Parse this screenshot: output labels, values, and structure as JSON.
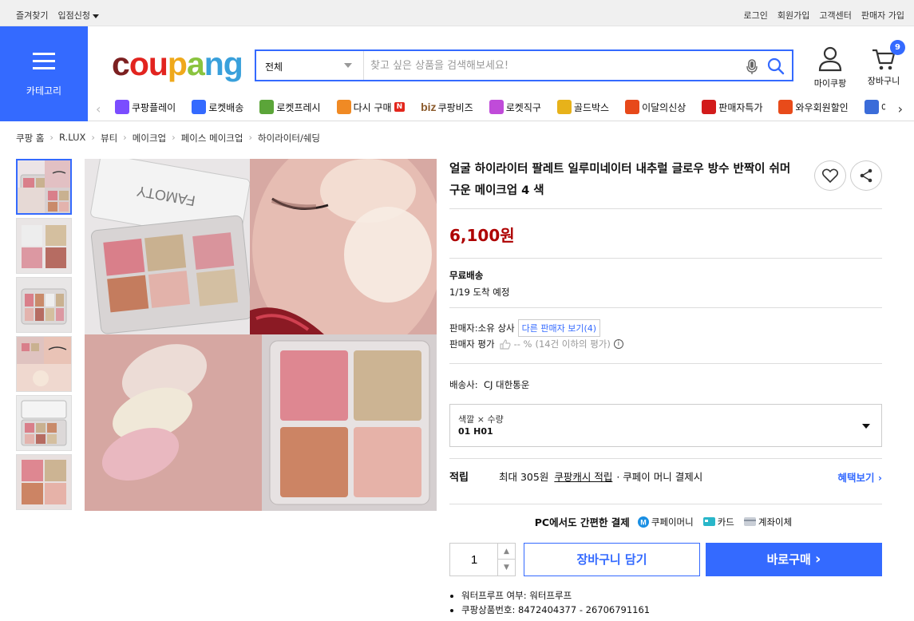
{
  "topbar": {
    "favorites": "즐겨찾기",
    "store_apply": "입점신청",
    "login": "로그인",
    "signup": "회원가입",
    "customer_center": "고객센터",
    "seller_signup": "판매자 가입"
  },
  "category": {
    "label": "카테고리"
  },
  "logo": {
    "c": "c",
    "ou": "ou",
    "p": "p",
    "a": "a",
    "ng": "ng"
  },
  "search": {
    "category": "전체",
    "placeholder": "찾고 싶은 상품을 검색해보세요!"
  },
  "header": {
    "my_coupang": "마이쿠팡",
    "cart": "장바구니",
    "cart_count": "9"
  },
  "service_nav": [
    {
      "label": "쿠팡플레이",
      "color": "#7b4dff"
    },
    {
      "label": "로켓배송",
      "color": "#346aff"
    },
    {
      "label": "로켓프레시",
      "color": "#5ba539"
    },
    {
      "label": "다시 구매",
      "color": "#f08a24"
    },
    {
      "label": "쿠팡비즈",
      "color": "#8b5a2b"
    },
    {
      "label": "로켓직구",
      "color": "#c04bd9"
    },
    {
      "label": "골드박스",
      "color": "#e7b21a"
    },
    {
      "label": "이달의신상",
      "color": "#e7491a"
    },
    {
      "label": "판매자특가",
      "color": "#d21b1b"
    },
    {
      "label": "와우회원할인",
      "color": "#e84b1a"
    },
    {
      "label": "이",
      "color": "#3b6cd9"
    }
  ],
  "service_nav_extra": {
    "new_badge": "N",
    "biz_prefix": "biz"
  },
  "breadcrumb": [
    "쿠팡 홈",
    "R.LUX",
    "뷰티",
    "메이크업",
    "페이스 메이크업",
    "하이라이터/쉐딩"
  ],
  "product": {
    "title": "얼굴 하이라이터 팔레트 일루미네이터 내추럴 글로우 방수 반짝이 쉬머 구운 메이크업 4 색",
    "price": "6,100원",
    "shipping_label": "무료배송",
    "arrival": "1/19 도착 예정",
    "seller_prefix": "판매자:",
    "seller_name": "소유 상사",
    "other_sellers": "다른 판매자 보기(4)",
    "seller_rating_label": "판매자 평가",
    "seller_rating_value": "-- %",
    "seller_rating_note": "(14건 이하의 평가)",
    "carrier_label": "배송사:",
    "carrier_name": "CJ 대한통운",
    "option_label": "색깔 × 수량",
    "option_value": "01 H01",
    "reward_title": "적립",
    "reward_max": "최대 305원",
    "reward_link": "쿠팡캐시 적립",
    "reward_tail": "· 쿠페이 머니 결제시",
    "reward_more": "혜택보기",
    "pay_title": "PC에서도 간편한 결제",
    "pay_methods": [
      "쿠페이머니",
      "카드",
      "계좌이체"
    ],
    "quantity": "1",
    "add_to_cart": "장바구니 담기",
    "buy_now": "바로구매",
    "specs": [
      "워터프루프 여부: 워터프루프",
      "쿠팡상품번호: 8472404377 - 26706791161"
    ]
  },
  "colors": {
    "accent": "#346aff",
    "price": "#ae0000"
  }
}
